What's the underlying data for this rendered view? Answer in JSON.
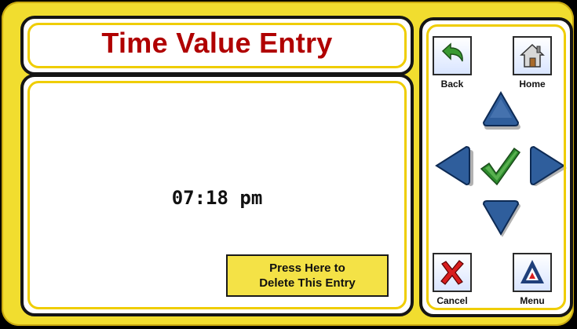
{
  "title": "Time Value Entry",
  "entry": {
    "value": "07:18 pm",
    "delete_label_line1": "Press Here to",
    "delete_label_line2": "Delete This Entry"
  },
  "nav": {
    "back_label": "Back",
    "home_label": "Home",
    "cancel_label": "Cancel",
    "menu_label": "Menu"
  },
  "colors": {
    "frame_yellow": "#f1dd2f",
    "title_red": "#b00000",
    "arrow_blue": "#2f5e9c",
    "check_green": "#2c8a2c"
  },
  "icons": [
    "back-arrow-icon",
    "home-icon",
    "up-arrow-icon",
    "left-arrow-icon",
    "checkmark-icon",
    "right-arrow-icon",
    "down-arrow-icon",
    "cancel-x-icon",
    "menu-logo-icon"
  ]
}
